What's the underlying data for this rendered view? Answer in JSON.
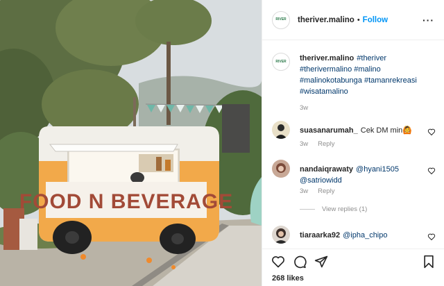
{
  "post": {
    "username": "theriver.malino",
    "follow_label": "Follow",
    "more_label": "···",
    "logo_text": "RIVER",
    "photo_sign": "FOOD N BEVERAGE"
  },
  "caption": {
    "username": "theriver.malino",
    "text": "#theriver #therivermalino #malino #malinokotabunga #tamanrekreasi #wisatamalino",
    "time": "3w"
  },
  "comments": [
    {
      "username": "suasanarumah_",
      "text": "Cek DM min🙆",
      "time": "3w",
      "reply_label": "Reply"
    },
    {
      "username": "nandaiqrawaty",
      "text": "@hyani1505 @satriowidd",
      "time": "3w",
      "reply_label": "Reply",
      "view_replies": "View replies (1)"
    },
    {
      "username": "tiaraarka92",
      "text": "@ipha_chipo"
    }
  ],
  "footer": {
    "likes": "268 likes"
  },
  "colors": {
    "follow": "#0095f6",
    "truck_orange": "#f2a94a",
    "truck_sign": "#a24a37"
  }
}
